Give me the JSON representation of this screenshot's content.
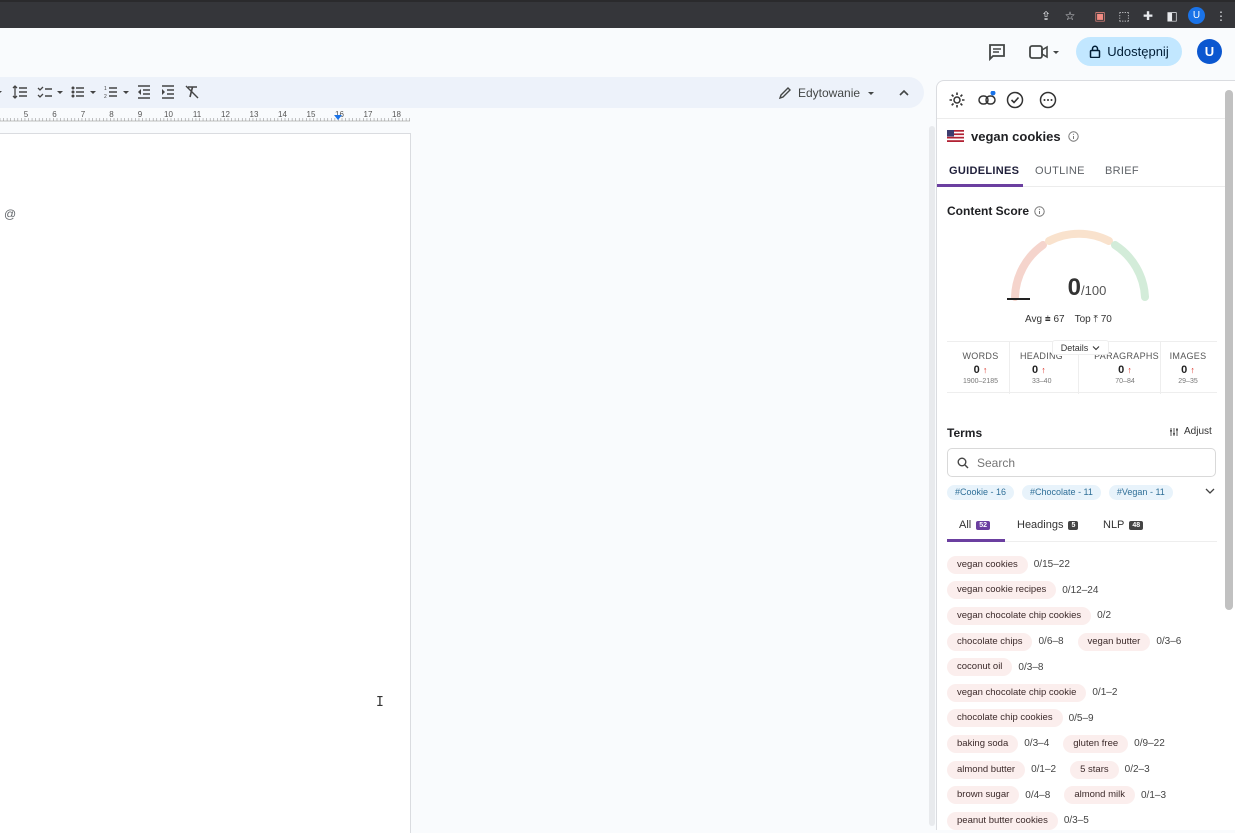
{
  "header": {
    "share_label": "Udostępnij",
    "user_initial": "U",
    "chrome_avatar_initial": "U"
  },
  "toolbar": {
    "edit_mode_label": "Edytowanie"
  },
  "ruler": {
    "labels": [
      "5",
      "6",
      "7",
      "8",
      "9",
      "10",
      "11",
      "12",
      "13",
      "14",
      "15",
      "16",
      "17",
      "18"
    ]
  },
  "document": {
    "text": "@",
    "cursor_glyph": "I"
  },
  "panel": {
    "keyword": "vegan cookies",
    "tabs": [
      "GUIDELINES",
      "OUTLINE",
      "BRIEF"
    ],
    "active_tab": "GUIDELINES",
    "content_score": {
      "title": "Content Score",
      "value": "0",
      "max": "/100",
      "avg_label": "Avg",
      "avg_value": "67",
      "top_label": "Top",
      "top_value": "70",
      "details_label": "Details"
    },
    "stats": [
      {
        "label": "WORDS",
        "value": "0",
        "range": "1900–2185"
      },
      {
        "label": "HEADINGS",
        "value": "0",
        "range": "33–40"
      },
      {
        "label": "PARAGRAPHS",
        "value": "0",
        "range": "70–84"
      },
      {
        "label": "IMAGES",
        "value": "0",
        "range": "29–35"
      }
    ],
    "terms": {
      "title": "Terms",
      "adjust_label": "Adjust",
      "search_placeholder": "Search",
      "chips": [
        "#Cookie - 16",
        "#Chocolate - 11",
        "#Vegan - 11"
      ],
      "filter_tabs": [
        {
          "label": "All",
          "count": "52"
        },
        {
          "label": "Headings",
          "count": "5"
        },
        {
          "label": "NLP",
          "count": "48"
        }
      ],
      "rows": [
        [
          {
            "term": "vegan cookies",
            "count": "0/15–22"
          }
        ],
        [
          {
            "term": "vegan cookie recipes",
            "count": "0/12–24"
          }
        ],
        [
          {
            "term": "vegan chocolate chip cookies",
            "count": "0/2"
          }
        ],
        [
          {
            "term": "chocolate chips",
            "count": "0/6–8"
          },
          {
            "term": "vegan butter",
            "count": "0/3–6"
          }
        ],
        [
          {
            "term": "coconut oil",
            "count": "0/3–8"
          }
        ],
        [
          {
            "term": "vegan chocolate chip cookie",
            "count": "0/1–2"
          }
        ],
        [
          {
            "term": "chocolate chip cookies",
            "count": "0/5–9"
          }
        ],
        [
          {
            "term": "baking soda",
            "count": "0/3–4"
          },
          {
            "term": "gluten free",
            "count": "0/9–22"
          }
        ],
        [
          {
            "term": "almond butter",
            "count": "0/1–2"
          },
          {
            "term": "5 stars",
            "count": "0/2–3"
          }
        ],
        [
          {
            "term": "brown sugar",
            "count": "0/4–8"
          },
          {
            "term": "almond milk",
            "count": "0/1–3"
          }
        ],
        [
          {
            "term": "peanut butter cookies",
            "count": "0/3–5"
          }
        ]
      ]
    }
  },
  "colors": {
    "accent": "#6b3fa0",
    "share_bg": "#c2e7ff",
    "avatar": "#0b57d0",
    "term_pill_bg": "#fbeeed",
    "chip_bg": "#e8f3fb"
  }
}
